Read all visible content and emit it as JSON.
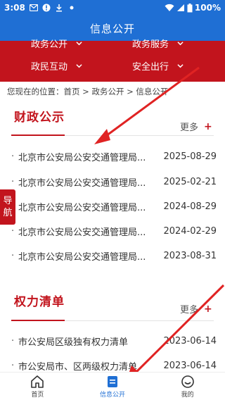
{
  "status_bar": {
    "time": "3:08",
    "battery": "100%"
  },
  "header": {
    "title": "信息公开"
  },
  "nav_menu": {
    "items": [
      {
        "label": "政务公开"
      },
      {
        "label": "政务服务"
      },
      {
        "label": "政民互动"
      },
      {
        "label": "安全出行"
      }
    ]
  },
  "breadcrumb": {
    "text": "您现在的位置：首页 > 政务公开 > 信息公开"
  },
  "side_tab": {
    "line1": "导",
    "line2": "航"
  },
  "sections": [
    {
      "title": "财政公示",
      "more_label": "更多",
      "plus": "+",
      "items": [
        {
          "title": "北京市公安局公安交通管理局...",
          "date": "2025-08-29"
        },
        {
          "title": "北京市公安局公安交通管理局...",
          "date": "2025-02-21"
        },
        {
          "title": "北京市公安局公安交通管理局...",
          "date": "2024-08-29"
        },
        {
          "title": "北京市公安局公安交通管理局...",
          "date": "2024-02-29"
        },
        {
          "title": "北京市公安局公安交通管理局...",
          "date": "2023-08-31"
        }
      ]
    },
    {
      "title": "权力清单",
      "more_label": "更多",
      "plus": "+",
      "items": [
        {
          "title": "市公安局区级独有权力清单",
          "date": "2023-06-14"
        },
        {
          "title": "市公安局市、区两级权力清单",
          "date": "2023-06-14"
        }
      ]
    }
  ],
  "tabbar": {
    "items": [
      {
        "label": "首页",
        "icon": "home-icon"
      },
      {
        "label": "信息公开",
        "icon": "document-icon"
      },
      {
        "label": "我的",
        "icon": "smile-icon"
      }
    ],
    "active_color": "#1f6fd4"
  },
  "colors": {
    "brand_blue": "#1f6fd4",
    "accent_red": "#c2141d",
    "arrow_red": "#e02323"
  }
}
